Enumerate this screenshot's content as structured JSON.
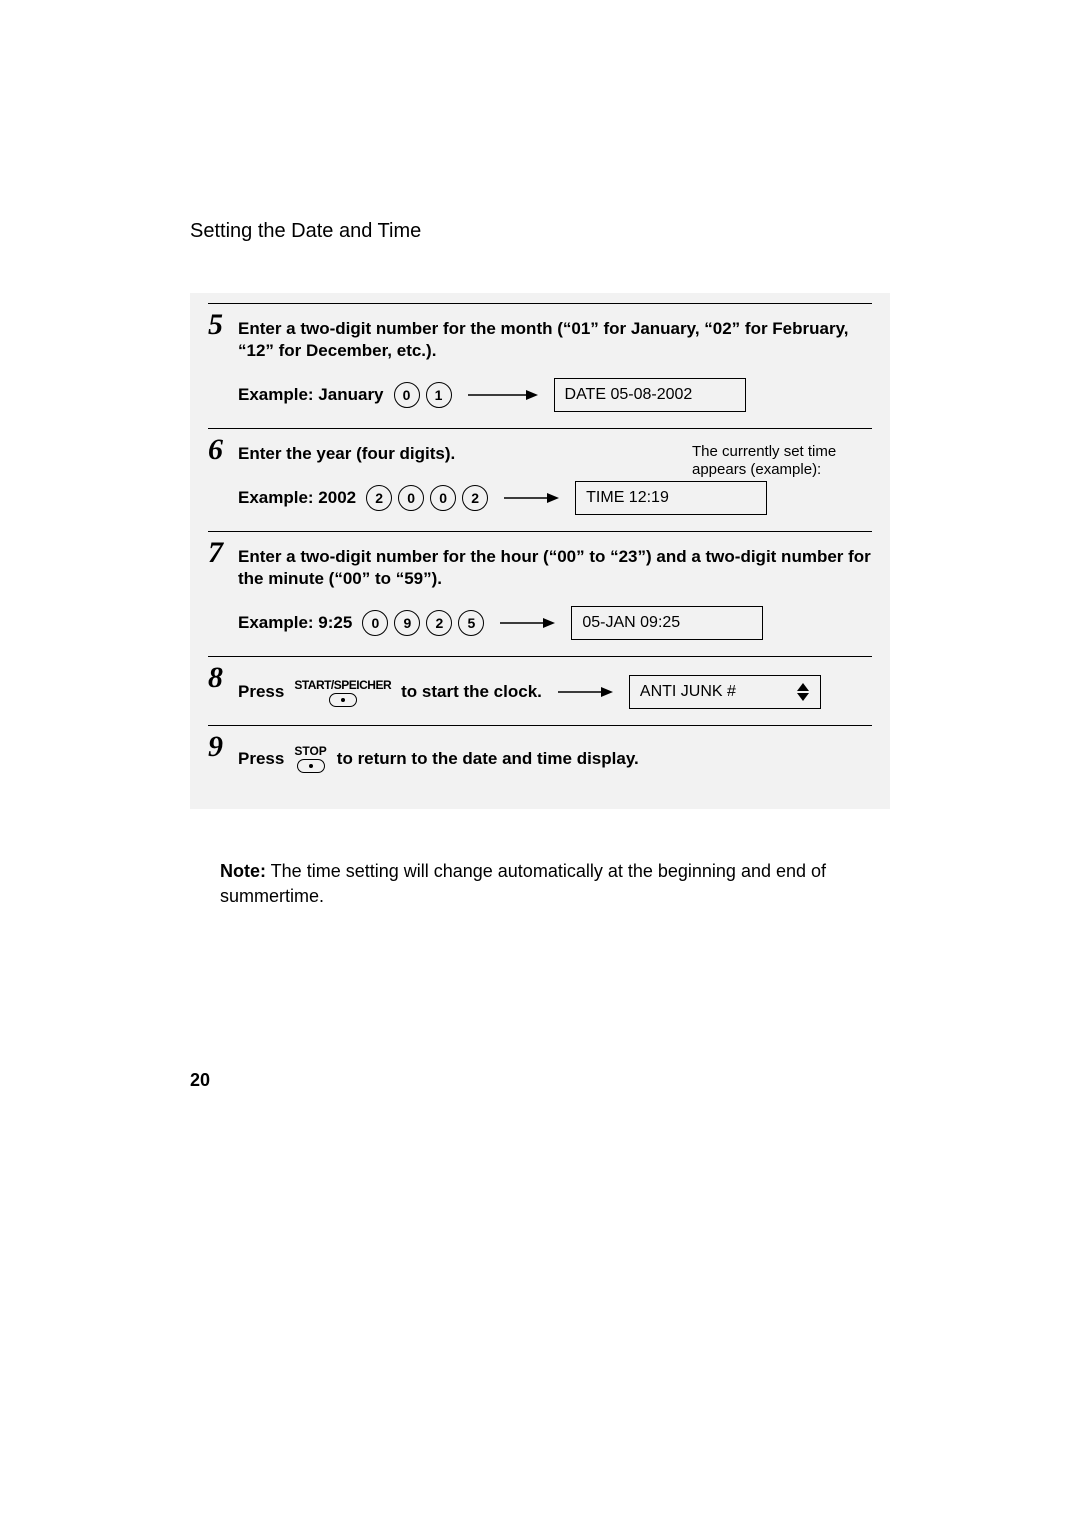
{
  "title": "Setting the Date and Time",
  "page_number": "20",
  "steps": {
    "s5": {
      "num": "5",
      "instruction": "Enter a two-digit number for the month (“01” for January, “02” for February, “12” for December, etc.).",
      "example_label": "Example: January",
      "digits": [
        "0",
        "1"
      ],
      "display": "DATE 05-08-2002"
    },
    "s6": {
      "num": "6",
      "instruction": "Enter the year (four digits).",
      "side_note": "The currently set time appears (example):",
      "example_label": "Example: 2002",
      "digits": [
        "2",
        "0",
        "0",
        "2"
      ],
      "display": "TIME 12:19"
    },
    "s7": {
      "num": "7",
      "instruction": "Enter a two-digit number for the hour (“00” to “23”) and a two-digit number for the minute (“00” to “59”).",
      "example_label": "Example: 9:25",
      "digits": [
        "0",
        "9",
        "2",
        "5"
      ],
      "display": "05-JAN 09:25"
    },
    "s8": {
      "num": "8",
      "press": "Press",
      "key_label": "START/SPEICHER",
      "after": " to start the clock.",
      "display": "ANTI JUNK #"
    },
    "s9": {
      "num": "9",
      "press": "Press",
      "key_label": "STOP",
      "after": " to return to the date and time display."
    }
  },
  "note_label": "Note:",
  "note_text": " The time setting will change automatically at the beginning and end of summertime."
}
